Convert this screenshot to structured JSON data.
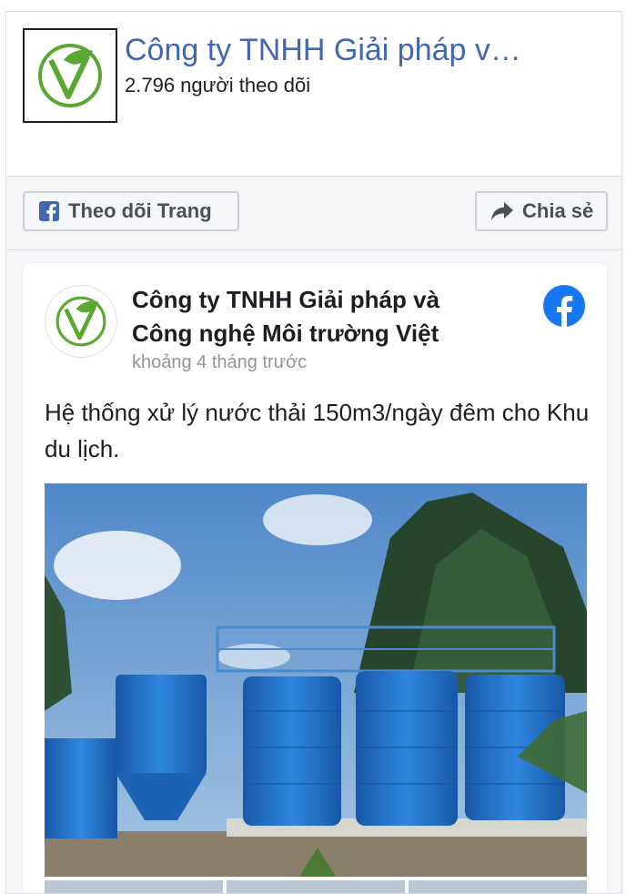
{
  "header": {
    "page_name": "Công ty TNHH Giải pháp v…",
    "followers": "2.796 người theo dõi",
    "logo_icon": "leaf-v-logo-icon"
  },
  "actions": {
    "follow_label": "Theo dõi Trang",
    "share_label": "Chia sẻ",
    "follow_icon": "facebook-square-icon",
    "share_icon": "share-arrow-icon"
  },
  "post": {
    "author": "Công ty TNHH Giải pháp và Công nghệ Môi trường Việt",
    "time": "khoảng 4 tháng trước",
    "text": "Hệ thống xử lý nước thải 150m3/ngày đêm cho Khu du lịch.",
    "badge_icon": "facebook-logo-icon"
  },
  "colors": {
    "link_blue": "#4267b2",
    "facebook_blue": "#1877f2",
    "tank_blue": "#1e6fc9",
    "logo_green": "#5aa832"
  }
}
